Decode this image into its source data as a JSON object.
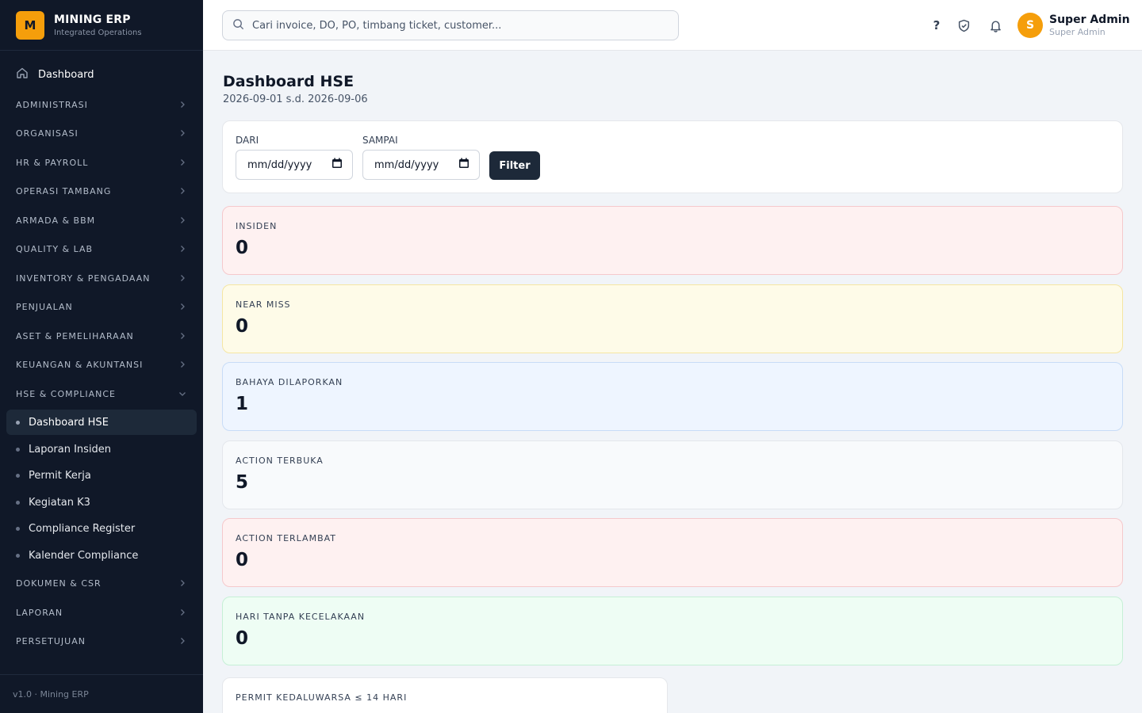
{
  "brand": {
    "logo_letter": "M",
    "name": "MINING ERP",
    "subtitle": "Integrated Operations"
  },
  "sidebar": {
    "dashboard": "Dashboard",
    "sections_top": [
      "ADMINISTRASI",
      "ORGANISASI",
      "HR & PAYROLL",
      "OPERASI TAMBANG",
      "ARMADA & BBM",
      "QUALITY & LAB",
      "INVENTORY & PENGADAAN",
      "PENJUALAN",
      "ASET & PEMELIHARAAN",
      "KEUANGAN & AKUNTANSI",
      "HSE & COMPLIANCE"
    ],
    "hse_items": [
      "Dashboard HSE",
      "Laporan Insiden",
      "Permit Kerja",
      "Kegiatan K3",
      "Compliance Register",
      "Kalender Compliance"
    ],
    "active_item": "Dashboard HSE",
    "sections_bottom": [
      "DOKUMEN & CSR",
      "LAPORAN",
      "PERSETUJUAN"
    ],
    "footer": "v1.0 · Mining ERP"
  },
  "topbar": {
    "search_placeholder": "Cari invoice, DO, PO, timbang ticket, customer...",
    "help_icon": "?",
    "user": {
      "avatar_letter": "S",
      "name": "Super Admin",
      "role": "Super Admin"
    }
  },
  "page": {
    "title": "Dashboard HSE",
    "subtitle": "2026-09-01 s.d. 2026-09-06"
  },
  "filter": {
    "from_label": "DARI",
    "to_label": "SAMPAI",
    "from_value": "mm/dd/yyyy",
    "to_value": "mm/dd/yyyy",
    "button": "Filter"
  },
  "stats": [
    {
      "label": "INSIDEN",
      "value": "0"
    },
    {
      "label": "NEAR MISS",
      "value": "0"
    },
    {
      "label": "BAHAYA DILAPORKAN",
      "value": "1"
    },
    {
      "label": "ACTION TERBUKA",
      "value": "5"
    },
    {
      "label": "ACTION TERLAMBAT",
      "value": "0"
    },
    {
      "label": "HARI TANPA KECELAKAAN",
      "value": "0"
    }
  ],
  "permit_card": {
    "label": "PERMIT KEDALUWARSA ≤ 14 HARI"
  },
  "colors": {
    "sidebar_bg": "#101828",
    "brand_accent": "#f59e0b",
    "filter_button": "#1d2939",
    "stat_red": "#fef1f1",
    "stat_yellow": "#fefbe8",
    "stat_blue": "#eef5ff",
    "stat_gray": "#f8fafc",
    "stat_green": "#eefdf4"
  }
}
